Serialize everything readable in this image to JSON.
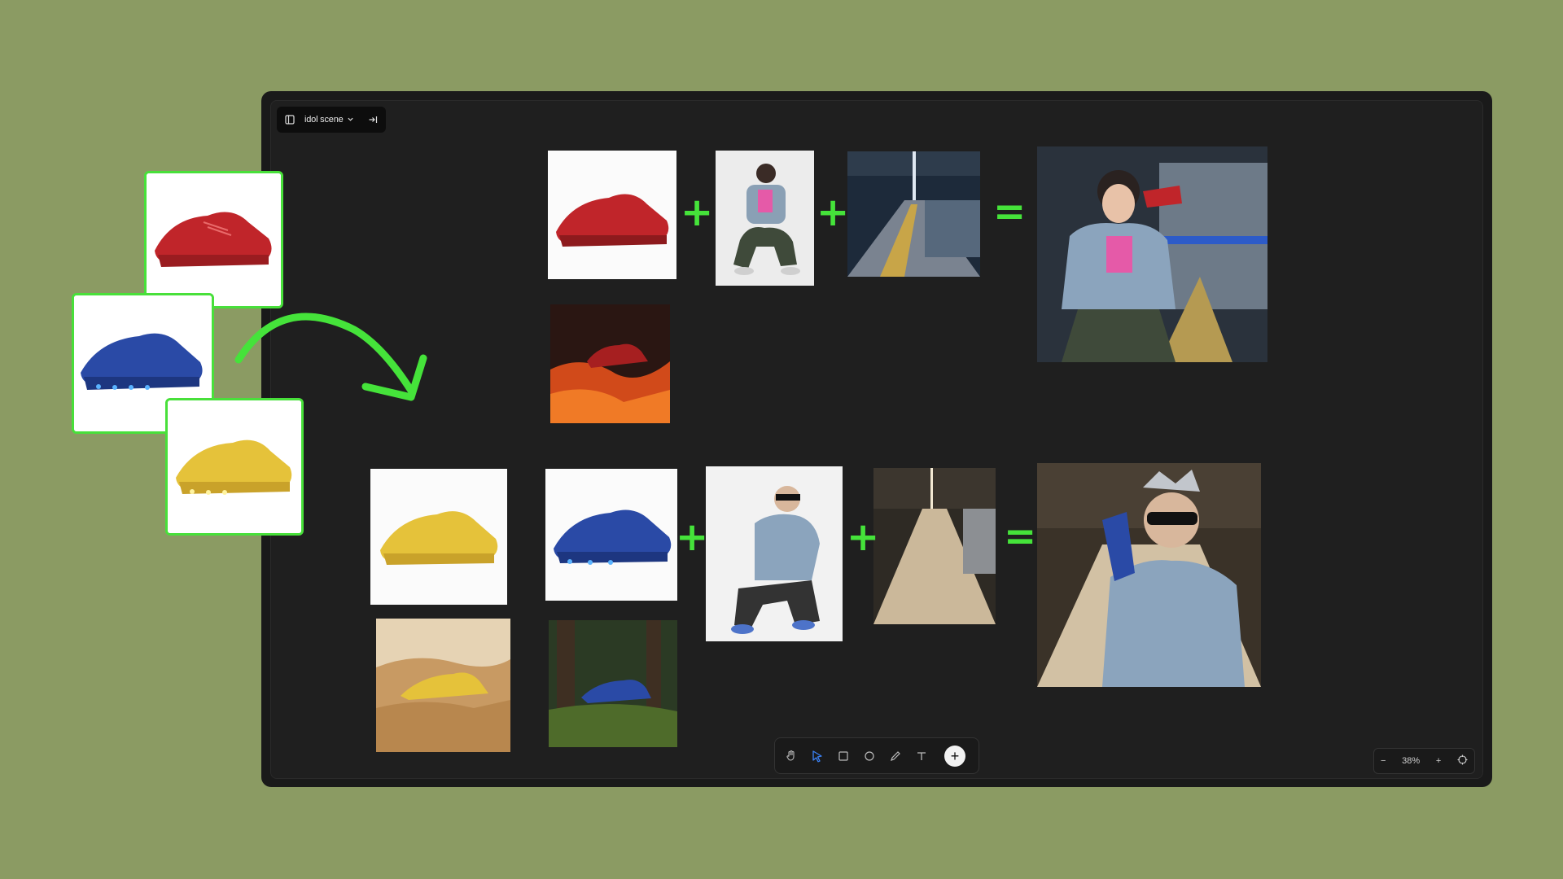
{
  "app": {
    "project_title": "idol scene",
    "zoom_level": "38%"
  },
  "icons": {
    "sidebar_toggle": "sidebar-toggle-icon",
    "dropdown": "chevron-down-icon",
    "collapse": "collapse-right-icon",
    "hand": "hand-icon",
    "select": "pointer-icon",
    "rectangle": "rectangle-icon",
    "ellipse": "circle-icon",
    "pencil": "pencil-icon",
    "text": "text-icon",
    "add": "plus-icon",
    "zoom_out": "minus-icon",
    "zoom_in": "plus-icon",
    "fit": "fit-view-icon"
  },
  "symbols": {
    "plus": "+",
    "equals": "="
  },
  "colors": {
    "accent_green": "#45e33a",
    "background": "#8b9b63",
    "canvas": "#1f1f1f"
  },
  "toolbar": {
    "zoom_out_label": "−",
    "zoom_in_label": "+",
    "add_label": "+"
  }
}
